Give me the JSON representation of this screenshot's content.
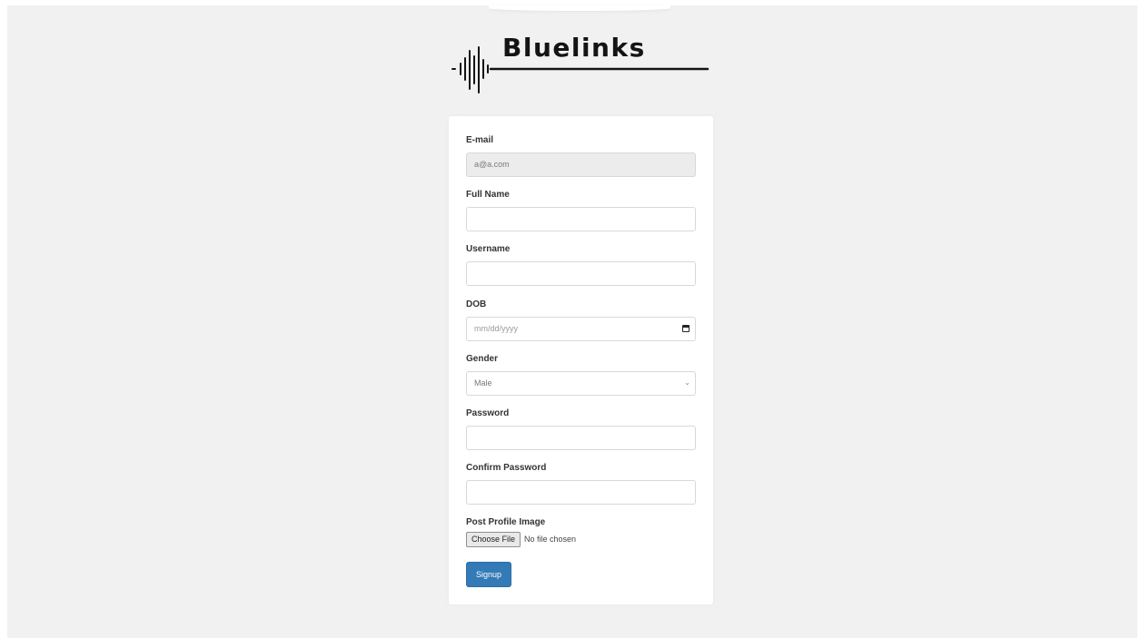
{
  "brand": {
    "name": "Bluelinks",
    "logo_icon": "sound-wave-icon",
    "text_color": "#141414"
  },
  "form": {
    "email": {
      "label": "E-mail",
      "value": "a@a.com"
    },
    "full_name": {
      "label": "Full Name",
      "value": ""
    },
    "username": {
      "label": "Username",
      "value": ""
    },
    "dob": {
      "label": "DOB",
      "placeholder": "mm/dd/yyyy",
      "icon": "calendar-icon"
    },
    "gender": {
      "label": "Gender",
      "selected": "Male",
      "icon": "chevron-down-icon"
    },
    "password": {
      "label": "Password",
      "value": ""
    },
    "confirm_password": {
      "label": "Confirm Password",
      "value": ""
    },
    "profile_image": {
      "label": "Post Profile Image",
      "button_label": "Choose File",
      "status": "No file chosen"
    },
    "submit_label": "Signup"
  },
  "colors": {
    "page_background": "#f1f1f1",
    "card_background": "#ffffff",
    "primary_button": "#337ab7"
  }
}
